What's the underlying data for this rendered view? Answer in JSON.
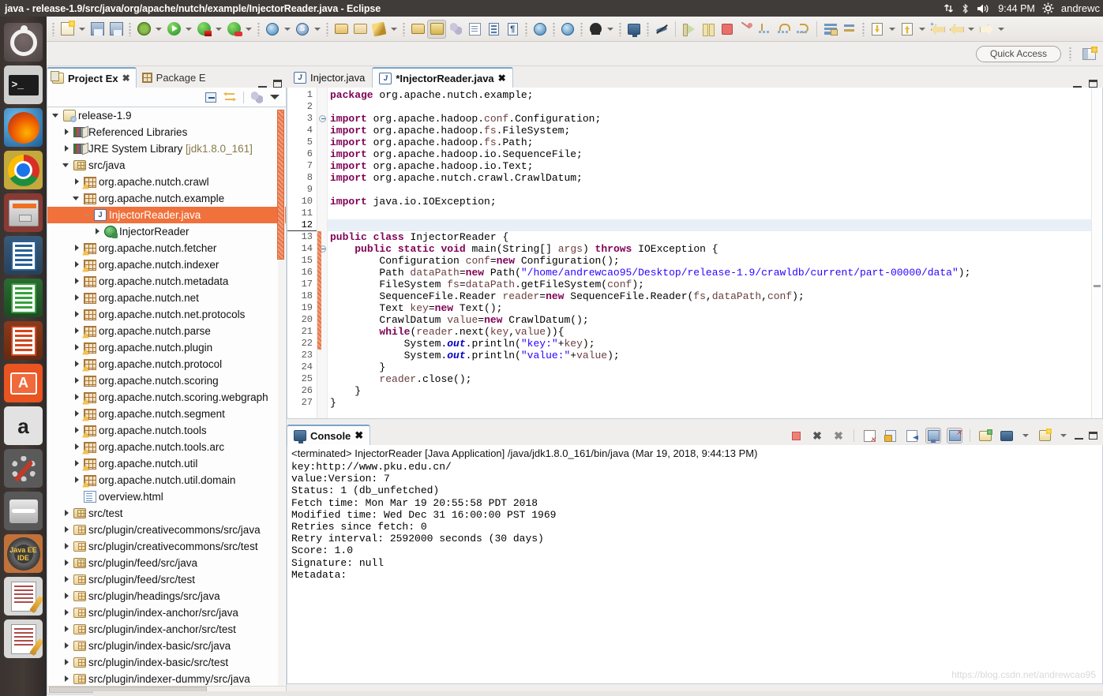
{
  "panel": {
    "window_title": "java - release-1.9/src/java/org/apache/nutch/example/InjectorReader.java - Eclipse",
    "indicators": [
      "network-icon",
      "bluetooth-icon",
      "volume-icon"
    ],
    "clock": "9:44 PM",
    "gear": "gear-icon",
    "username": "andrewc"
  },
  "launcher": {
    "items": [
      {
        "name": "ubuntu-dash",
        "label": "Dash home"
      },
      {
        "name": "terminal",
        "label": "Terminal"
      },
      {
        "name": "firefox",
        "label": "Firefox"
      },
      {
        "name": "chrome",
        "label": "Google Chrome"
      },
      {
        "name": "files",
        "label": "Files"
      },
      {
        "name": "libreoffice-writer",
        "label": "LibreOffice Writer"
      },
      {
        "name": "libreoffice-calc",
        "label": "LibreOffice Calc"
      },
      {
        "name": "libreoffice-impress",
        "label": "LibreOffice Impress"
      },
      {
        "name": "ubuntu-software",
        "label": "Ubuntu Software"
      },
      {
        "name": "amazon",
        "label": "Amazon"
      },
      {
        "name": "system-settings",
        "label": "System Settings"
      },
      {
        "name": "trash",
        "label": "Trash"
      },
      {
        "name": "eclipse-java-ee",
        "label": "Java EE IDE"
      },
      {
        "name": "text-editor-1",
        "label": "Text Editor"
      },
      {
        "name": "text-editor-2",
        "label": "Text Editor"
      }
    ]
  },
  "toolbar": {
    "groups": [
      [
        "new-document-icon",
        "dropdown",
        "save-icon",
        "save-all-icon"
      ],
      [
        "debug-icon",
        "dropdown",
        "run-icon",
        "dropdown",
        "run-coverage-icon",
        "dropdown",
        "run-server-icon",
        "dropdown"
      ],
      [
        "new-web-project-icon",
        "dropdown",
        "new-server-icon",
        "dropdown"
      ],
      [
        "open-type-icon",
        "open-folder-icon",
        "edit-pen-icon",
        "dropdown"
      ],
      [
        "search-icon",
        "marker-icon",
        "balls-icon",
        "task-icon",
        "outline-icon",
        "paragraph-icon"
      ],
      [
        "browser-icon"
      ],
      [
        "deploy-icon"
      ],
      [
        "profile-icon",
        "dropdown"
      ],
      [
        "console-icon"
      ],
      [
        "skip-breakpoints-icon"
      ],
      [
        "resume-icon",
        "suspend-icon",
        "terminate-icon",
        "disconnect-icon",
        "step-into-icon",
        "step-over-icon",
        "step-return-icon"
      ],
      [
        "lines-icon",
        "swap-icon"
      ],
      [
        "import-icon",
        "dropdown",
        "export-icon"
      ],
      [
        "back-annotation-icon",
        "back-icon",
        "dropdown",
        "forward-icon",
        "dropdown"
      ]
    ],
    "quick_access_placeholder": "Quick Access",
    "perspective_icon": "open-perspective-icon"
  },
  "project_explorer": {
    "tabs": [
      {
        "label": "Project Ex",
        "icon": "project-explorer-icon",
        "active": true,
        "closable": true
      },
      {
        "label": "Package E",
        "icon": "package-explorer-icon",
        "active": false,
        "closable": false
      }
    ],
    "view_buttons": [
      "collapse-all-icon",
      "link-with-editor-icon",
      "filter-icon",
      "view-menu-icon"
    ],
    "window_buttons": [
      "minimize-icon",
      "maximize-icon"
    ],
    "tree": [
      {
        "label": "release-1.9",
        "indent": 0,
        "twist": "open",
        "icon": "java-project-icon"
      },
      {
        "label": "Referenced Libraries",
        "indent": 1,
        "twist": "closed",
        "icon": "library-icon"
      },
      {
        "label": "JRE System Library [jdk1.8.0_161]",
        "indent": 1,
        "twist": "closed",
        "icon": "library-icon"
      },
      {
        "label": "src/java",
        "indent": 1,
        "twist": "open",
        "icon": "source-folder-icon"
      },
      {
        "label": "org.apache.nutch.crawl",
        "indent": 2,
        "twist": "closed",
        "icon": "package-warning-icon"
      },
      {
        "label": "org.apache.nutch.example",
        "indent": 2,
        "twist": "open",
        "icon": "package-icon"
      },
      {
        "label": "InjectorReader.java",
        "indent": 3,
        "twist": "dash",
        "icon": "java-file-icon",
        "selected": true
      },
      {
        "label": "InjectorReader",
        "indent": 4,
        "twist": "closed",
        "icon": "java-class-icon"
      },
      {
        "label": "org.apache.nutch.fetcher",
        "indent": 2,
        "twist": "closed",
        "icon": "package-warning-icon"
      },
      {
        "label": "org.apache.nutch.indexer",
        "indent": 2,
        "twist": "closed",
        "icon": "package-warning-icon"
      },
      {
        "label": "org.apache.nutch.metadata",
        "indent": 2,
        "twist": "closed",
        "icon": "package-icon"
      },
      {
        "label": "org.apache.nutch.net",
        "indent": 2,
        "twist": "closed",
        "icon": "package-icon"
      },
      {
        "label": "org.apache.nutch.net.protocols",
        "indent": 2,
        "twist": "closed",
        "icon": "package-icon"
      },
      {
        "label": "org.apache.nutch.parse",
        "indent": 2,
        "twist": "closed",
        "icon": "package-warning-icon"
      },
      {
        "label": "org.apache.nutch.plugin",
        "indent": 2,
        "twist": "closed",
        "icon": "package-warning-icon"
      },
      {
        "label": "org.apache.nutch.protocol",
        "indent": 2,
        "twist": "closed",
        "icon": "package-warning-icon"
      },
      {
        "label": "org.apache.nutch.scoring",
        "indent": 2,
        "twist": "closed",
        "icon": "package-icon"
      },
      {
        "label": "org.apache.nutch.scoring.webgraph",
        "indent": 2,
        "twist": "closed",
        "icon": "package-warning-icon"
      },
      {
        "label": "org.apache.nutch.segment",
        "indent": 2,
        "twist": "closed",
        "icon": "package-warning-icon"
      },
      {
        "label": "org.apache.nutch.tools",
        "indent": 2,
        "twist": "closed",
        "icon": "package-warning-icon"
      },
      {
        "label": "org.apache.nutch.tools.arc",
        "indent": 2,
        "twist": "closed",
        "icon": "package-warning-icon"
      },
      {
        "label": "org.apache.nutch.util",
        "indent": 2,
        "twist": "closed",
        "icon": "package-warning-icon"
      },
      {
        "label": "org.apache.nutch.util.domain",
        "indent": 2,
        "twist": "closed",
        "icon": "package-warning-icon"
      },
      {
        "label": "overview.html",
        "indent": 2,
        "twist": "none",
        "icon": "html-file-icon"
      },
      {
        "label": "src/test",
        "indent": 1,
        "twist": "closed",
        "icon": "source-folder-warning-icon"
      },
      {
        "label": "src/plugin/creativecommons/src/java",
        "indent": 1,
        "twist": "closed",
        "icon": "plugin-folder-icon"
      },
      {
        "label": "src/plugin/creativecommons/src/test",
        "indent": 1,
        "twist": "closed",
        "icon": "plugin-folder-icon"
      },
      {
        "label": "src/plugin/feed/src/java",
        "indent": 1,
        "twist": "closed",
        "icon": "source-folder-warning-icon"
      },
      {
        "label": "src/plugin/feed/src/test",
        "indent": 1,
        "twist": "closed",
        "icon": "plugin-folder-icon"
      },
      {
        "label": "src/plugin/headings/src/java",
        "indent": 1,
        "twist": "closed",
        "icon": "plugin-folder-icon"
      },
      {
        "label": "src/plugin/index-anchor/src/java",
        "indent": 1,
        "twist": "closed",
        "icon": "plugin-folder-icon"
      },
      {
        "label": "src/plugin/index-anchor/src/test",
        "indent": 1,
        "twist": "closed",
        "icon": "plugin-folder-icon"
      },
      {
        "label": "src/plugin/index-basic/src/java",
        "indent": 1,
        "twist": "closed",
        "icon": "plugin-folder-icon"
      },
      {
        "label": "src/plugin/index-basic/src/test",
        "indent": 1,
        "twist": "closed",
        "icon": "plugin-folder-icon"
      },
      {
        "label": "src/plugin/indexer-dummy/src/java",
        "indent": 1,
        "twist": "closed",
        "icon": "plugin-folder-icon"
      }
    ]
  },
  "editor": {
    "tabs": [
      {
        "label": "Injector.java",
        "icon": "java-file-icon",
        "active": false,
        "closable": false
      },
      {
        "label": "*InjectorReader.java",
        "icon": "java-file-icon",
        "active": true,
        "closable": true
      }
    ],
    "window_buttons": [
      "minimize-icon",
      "maximize-icon"
    ],
    "current_line": 12,
    "lines": [
      {
        "n": 1,
        "fold": false,
        "text": "package org.apache.nutch.example;"
      },
      {
        "n": 2,
        "fold": false,
        "text": ""
      },
      {
        "n": 3,
        "fold": true,
        "text": "import org.apache.hadoop.conf.Configuration;"
      },
      {
        "n": 4,
        "fold": false,
        "text": "import org.apache.hadoop.fs.FileSystem;"
      },
      {
        "n": 5,
        "fold": false,
        "text": "import org.apache.hadoop.fs.Path;"
      },
      {
        "n": 6,
        "fold": false,
        "text": "import org.apache.hadoop.io.SequenceFile;"
      },
      {
        "n": 7,
        "fold": false,
        "text": "import org.apache.hadoop.io.Text;"
      },
      {
        "n": 8,
        "fold": false,
        "text": "import org.apache.nutch.crawl.CrawlDatum;"
      },
      {
        "n": 9,
        "fold": false,
        "text": ""
      },
      {
        "n": 10,
        "fold": false,
        "text": "import java.io.IOException;"
      },
      {
        "n": 11,
        "fold": false,
        "text": ""
      },
      {
        "n": 12,
        "fold": false,
        "text": ""
      },
      {
        "n": 13,
        "fold": false,
        "text": "public class InjectorReader {"
      },
      {
        "n": 14,
        "fold": true,
        "text": "    public static void main(String[] args) throws IOException {"
      },
      {
        "n": 15,
        "fold": false,
        "text": "        Configuration conf=new Configuration();"
      },
      {
        "n": 16,
        "fold": false,
        "text": "        Path dataPath=new Path(\"/home/andrewcao95/Desktop/release-1.9/crawldb/current/part-00000/data\");"
      },
      {
        "n": 17,
        "fold": false,
        "text": "        FileSystem fs=dataPath.getFileSystem(conf);"
      },
      {
        "n": 18,
        "fold": false,
        "text": "        SequenceFile.Reader reader=new SequenceFile.Reader(fs,dataPath,conf);"
      },
      {
        "n": 19,
        "fold": false,
        "text": "        Text key=new Text();"
      },
      {
        "n": 20,
        "fold": false,
        "text": "        CrawlDatum value=new CrawlDatum();"
      },
      {
        "n": 21,
        "fold": false,
        "text": "        while(reader.next(key,value)){"
      },
      {
        "n": 22,
        "fold": false,
        "text": "            System.out.println(\"key:\"+key);"
      },
      {
        "n": 23,
        "fold": false,
        "text": "            System.out.println(\"value:\"+value);"
      },
      {
        "n": 24,
        "fold": false,
        "text": "        }"
      },
      {
        "n": 25,
        "fold": false,
        "text": "        reader.close();"
      },
      {
        "n": 26,
        "fold": false,
        "text": "    }"
      },
      {
        "n": 27,
        "fold": false,
        "text": "}"
      }
    ]
  },
  "console": {
    "tab_label": "Console",
    "tab_icon": "console-icon",
    "toolbar": [
      "terminate-icon",
      "remove-launch-icon",
      "remove-all-terminated-icon",
      "clear-console-icon",
      "scroll-lock-icon",
      "word-wrap-icon",
      "show-console-on-output-icon",
      "pin-console-icon",
      "open-console-icon",
      "display-selected-console-icon",
      "dropdown",
      "new-console-view-icon",
      "dropdown"
    ],
    "window_buttons": [
      "minimize-icon",
      "maximize-icon"
    ],
    "header": "<terminated> InjectorReader [Java Application] /java/jdk1.8.0_161/bin/java (Mar 19, 2018, 9:44:13 PM)",
    "output": [
      "key:http://www.pku.edu.cn/",
      "value:Version: 7",
      "Status: 1 (db_unfetched)",
      "Fetch time: Mon Mar 19 20:55:58 PDT 2018",
      "Modified time: Wed Dec 31 16:00:00 PST 1969",
      "Retries since fetch: 0",
      "Retry interval: 2592000 seconds (30 days)",
      "Score: 1.0",
      "Signature: null",
      "Metadata:"
    ],
    "watermark": "https://blog.csdn.net/andrewcao95"
  },
  "colors": {
    "panel_bg": "#403c39",
    "selection_orange": "#f0713c",
    "keyword_purple": "#7f0055",
    "string_blue": "#2a00ff",
    "field_blue": "#0000c0",
    "local_brown": "#6a3e3e",
    "tab_accent": "#7aa4cc"
  }
}
